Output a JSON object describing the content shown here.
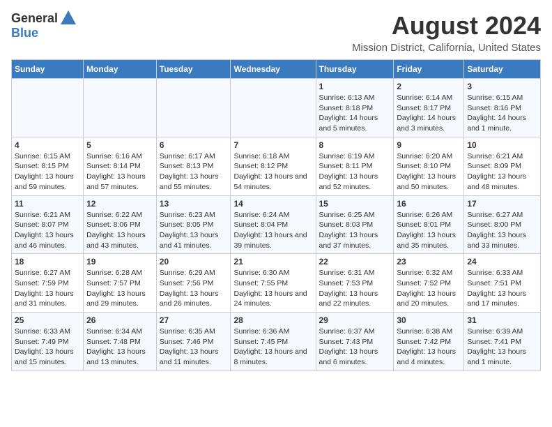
{
  "header": {
    "logo_general": "General",
    "logo_blue": "Blue",
    "title": "August 2024",
    "subtitle": "Mission District, California, United States"
  },
  "calendar": {
    "days_of_week": [
      "Sunday",
      "Monday",
      "Tuesday",
      "Wednesday",
      "Thursday",
      "Friday",
      "Saturday"
    ],
    "weeks": [
      {
        "days": [
          {
            "number": "",
            "info": ""
          },
          {
            "number": "",
            "info": ""
          },
          {
            "number": "",
            "info": ""
          },
          {
            "number": "",
            "info": ""
          },
          {
            "number": "1",
            "info": "Sunrise: 6:13 AM\nSunset: 8:18 PM\nDaylight: 14 hours\nand 5 minutes."
          },
          {
            "number": "2",
            "info": "Sunrise: 6:14 AM\nSunset: 8:17 PM\nDaylight: 14 hours\nand 3 minutes."
          },
          {
            "number": "3",
            "info": "Sunrise: 6:15 AM\nSunset: 8:16 PM\nDaylight: 14 hours\nand 1 minute."
          }
        ]
      },
      {
        "days": [
          {
            "number": "4",
            "info": "Sunrise: 6:15 AM\nSunset: 8:15 PM\nDaylight: 13 hours\nand 59 minutes."
          },
          {
            "number": "5",
            "info": "Sunrise: 6:16 AM\nSunset: 8:14 PM\nDaylight: 13 hours\nand 57 minutes."
          },
          {
            "number": "6",
            "info": "Sunrise: 6:17 AM\nSunset: 8:13 PM\nDaylight: 13 hours\nand 55 minutes."
          },
          {
            "number": "7",
            "info": "Sunrise: 6:18 AM\nSunset: 8:12 PM\nDaylight: 13 hours\nand 54 minutes."
          },
          {
            "number": "8",
            "info": "Sunrise: 6:19 AM\nSunset: 8:11 PM\nDaylight: 13 hours\nand 52 minutes."
          },
          {
            "number": "9",
            "info": "Sunrise: 6:20 AM\nSunset: 8:10 PM\nDaylight: 13 hours\nand 50 minutes."
          },
          {
            "number": "10",
            "info": "Sunrise: 6:21 AM\nSunset: 8:09 PM\nDaylight: 13 hours\nand 48 minutes."
          }
        ]
      },
      {
        "days": [
          {
            "number": "11",
            "info": "Sunrise: 6:21 AM\nSunset: 8:07 PM\nDaylight: 13 hours\nand 46 minutes."
          },
          {
            "number": "12",
            "info": "Sunrise: 6:22 AM\nSunset: 8:06 PM\nDaylight: 13 hours\nand 43 minutes."
          },
          {
            "number": "13",
            "info": "Sunrise: 6:23 AM\nSunset: 8:05 PM\nDaylight: 13 hours\nand 41 minutes."
          },
          {
            "number": "14",
            "info": "Sunrise: 6:24 AM\nSunset: 8:04 PM\nDaylight: 13 hours\nand 39 minutes."
          },
          {
            "number": "15",
            "info": "Sunrise: 6:25 AM\nSunset: 8:03 PM\nDaylight: 13 hours\nand 37 minutes."
          },
          {
            "number": "16",
            "info": "Sunrise: 6:26 AM\nSunset: 8:01 PM\nDaylight: 13 hours\nand 35 minutes."
          },
          {
            "number": "17",
            "info": "Sunrise: 6:27 AM\nSunset: 8:00 PM\nDaylight: 13 hours\nand 33 minutes."
          }
        ]
      },
      {
        "days": [
          {
            "number": "18",
            "info": "Sunrise: 6:27 AM\nSunset: 7:59 PM\nDaylight: 13 hours\nand 31 minutes."
          },
          {
            "number": "19",
            "info": "Sunrise: 6:28 AM\nSunset: 7:57 PM\nDaylight: 13 hours\nand 29 minutes."
          },
          {
            "number": "20",
            "info": "Sunrise: 6:29 AM\nSunset: 7:56 PM\nDaylight: 13 hours\nand 26 minutes."
          },
          {
            "number": "21",
            "info": "Sunrise: 6:30 AM\nSunset: 7:55 PM\nDaylight: 13 hours\nand 24 minutes."
          },
          {
            "number": "22",
            "info": "Sunrise: 6:31 AM\nSunset: 7:53 PM\nDaylight: 13 hours\nand 22 minutes."
          },
          {
            "number": "23",
            "info": "Sunrise: 6:32 AM\nSunset: 7:52 PM\nDaylight: 13 hours\nand 20 minutes."
          },
          {
            "number": "24",
            "info": "Sunrise: 6:33 AM\nSunset: 7:51 PM\nDaylight: 13 hours\nand 17 minutes."
          }
        ]
      },
      {
        "days": [
          {
            "number": "25",
            "info": "Sunrise: 6:33 AM\nSunset: 7:49 PM\nDaylight: 13 hours\nand 15 minutes."
          },
          {
            "number": "26",
            "info": "Sunrise: 6:34 AM\nSunset: 7:48 PM\nDaylight: 13 hours\nand 13 minutes."
          },
          {
            "number": "27",
            "info": "Sunrise: 6:35 AM\nSunset: 7:46 PM\nDaylight: 13 hours\nand 11 minutes."
          },
          {
            "number": "28",
            "info": "Sunrise: 6:36 AM\nSunset: 7:45 PM\nDaylight: 13 hours\nand 8 minutes."
          },
          {
            "number": "29",
            "info": "Sunrise: 6:37 AM\nSunset: 7:43 PM\nDaylight: 13 hours\nand 6 minutes."
          },
          {
            "number": "30",
            "info": "Sunrise: 6:38 AM\nSunset: 7:42 PM\nDaylight: 13 hours\nand 4 minutes."
          },
          {
            "number": "31",
            "info": "Sunrise: 6:39 AM\nSunset: 7:41 PM\nDaylight: 13 hours\nand 1 minute."
          }
        ]
      }
    ]
  }
}
